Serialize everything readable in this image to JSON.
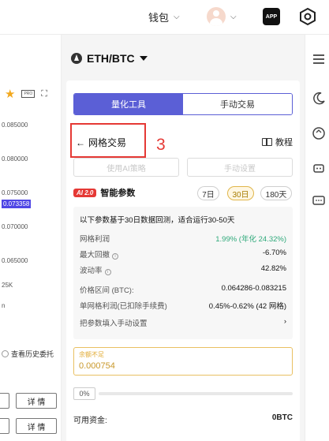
{
  "topbar": {
    "wallet_label": "钱包",
    "app_label": "APP"
  },
  "left": {
    "prices": [
      "0.085000",
      "0.080000",
      "0.075000",
      "0.073358",
      "0.070000",
      "0.065000"
    ],
    "volume_label": "25K",
    "small_label": "n",
    "history_label": "查看历史委托",
    "detail_label": "详 情",
    "box_label": "PRO"
  },
  "pair": {
    "symbol": "ETH/BTC"
  },
  "tabs": {
    "active": "量化工具",
    "inactive": "手动交易"
  },
  "grid": {
    "back_label": "网格交易",
    "step_number": "3",
    "tutorial_label": "教程",
    "use_ai_label": "使用AI策略",
    "manual_label": "手动设置"
  },
  "ai": {
    "badge": "AI 2.0",
    "title": "智能参数",
    "days": [
      "7日",
      "30日",
      "180天"
    ],
    "active_day": 1
  },
  "info": {
    "header": "以下参数基于30日数据回测，适合运行30-50天",
    "rows": [
      {
        "label": "网格利润",
        "value": "1.99% (年化 24.32%)",
        "green": true,
        "info": false
      },
      {
        "label": "最大回撤",
        "value": "-6.70%",
        "green": false,
        "info": true
      },
      {
        "label": "波动率",
        "value": "42.82%",
        "green": false,
        "info": true
      },
      {
        "label": "价格区间 (BTC):",
        "value": "0.064286-0.083215",
        "green": false,
        "info": false
      },
      {
        "label": "单网格利润(已扣除手续费)",
        "value": "0.45%-0.62% (42 网格)",
        "green": false,
        "info": false
      },
      {
        "label": "把参数填入手动设置",
        "value": "›",
        "green": false,
        "info": false
      }
    ],
    "info_glyph": "i"
  },
  "input": {
    "hint": "余额不足",
    "value": "0.000754"
  },
  "slider": {
    "percent": "0%"
  },
  "available": {
    "label": "可用资金:",
    "value": "0BTC"
  },
  "colors": {
    "accent": "#5b5fd6",
    "highlight_red": "#e53935",
    "profit_green": "#2ea97a",
    "warning": "#e9c062"
  }
}
